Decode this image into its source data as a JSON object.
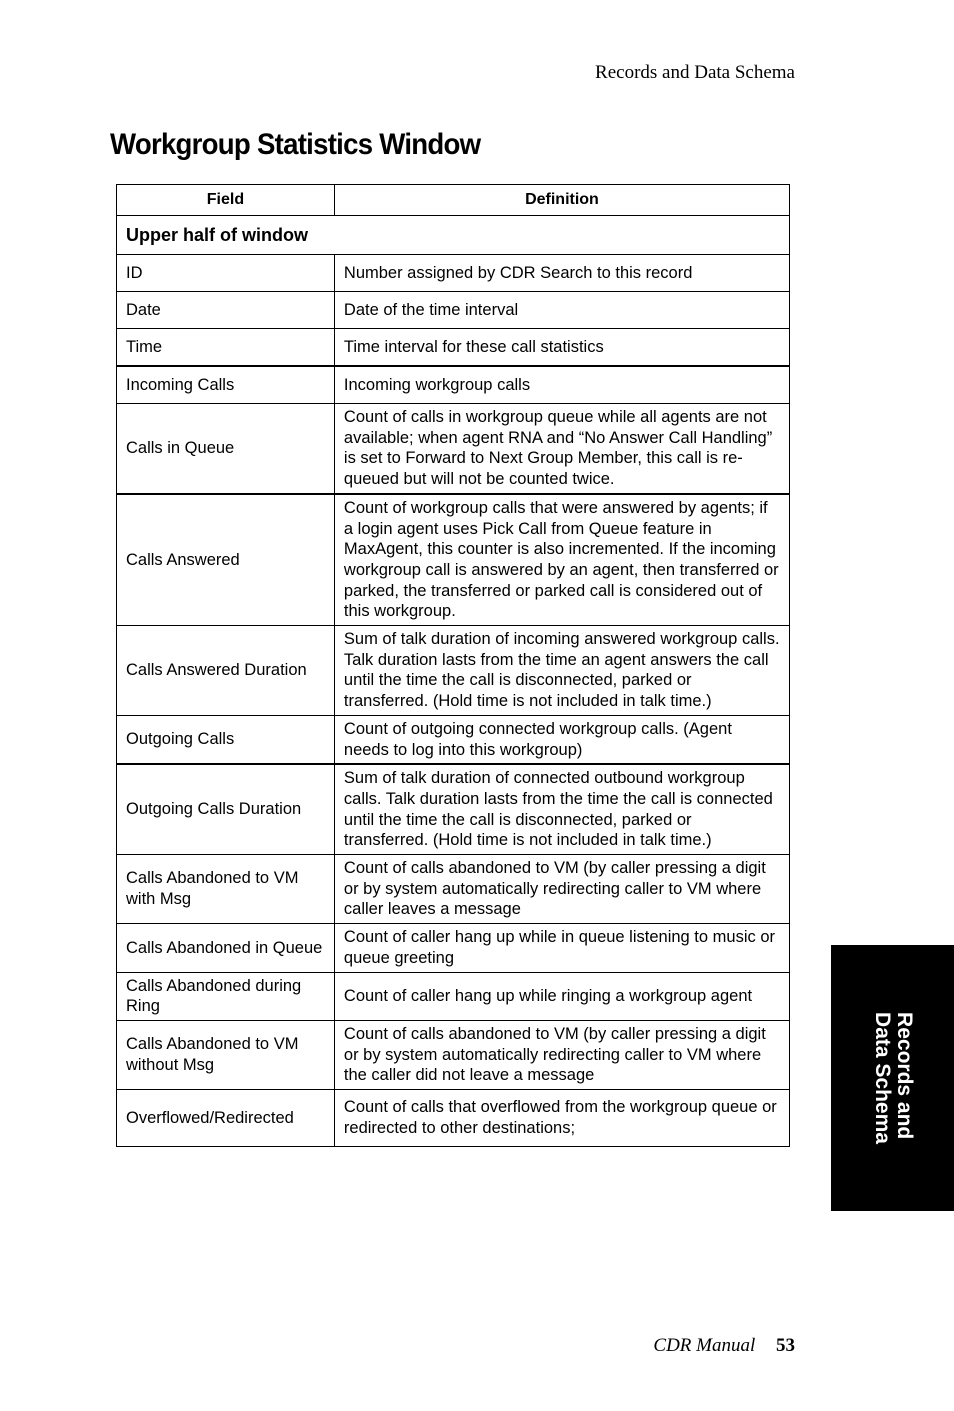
{
  "header": {
    "running_title": "Records and Data Schema"
  },
  "page_title": "Workgroup Statistics Window",
  "table": {
    "columns": [
      "Field",
      "Definition"
    ],
    "section_label": "Upper half of window",
    "rows": [
      {
        "field": "ID",
        "definition": "Number assigned by CDR Search to this record"
      },
      {
        "field": "Date",
        "definition": "Date of the time interval"
      },
      {
        "field": "Time",
        "definition": "Time interval for these call statistics"
      },
      {
        "field": "Incoming Calls",
        "definition": "Incoming workgroup calls"
      },
      {
        "field": "Calls in Queue",
        "definition": "Count of calls in workgroup queue while all agents are not available; when agent RNA and “No Answer Call Handling” is set to Forward to Next Group Member, this call is re-queued but will not be counted twice."
      },
      {
        "field": "Calls Answered",
        "definition": "Count of workgroup calls that were answered by agents; if a login agent uses Pick Call from Queue feature in MaxAgent, this counter is also incremented. If the incoming workgroup call is answered by an agent, then transferred or parked, the transferred or parked call is considered out of this workgroup."
      },
      {
        "field": "Calls Answered Duration",
        "definition": "Sum of talk duration of incoming answered workgroup calls. Talk duration lasts from the time an agent answers the call until the time the call is disconnected, parked or transferred. (Hold time is not included in talk time.)"
      },
      {
        "field": "Outgoing Calls",
        "definition": "Count of outgoing connected workgroup calls. (Agent needs to log into this workgroup)"
      },
      {
        "field": "Outgoing Calls Duration",
        "definition": "Sum of talk duration of connected outbound workgroup calls. Talk duration lasts from the time the call is connected until the time the call is disconnected, parked or transferred. (Hold time is not included in talk time.)"
      },
      {
        "field": "Calls Abandoned to VM with Msg",
        "definition": "Count of calls abandoned to VM (by caller pressing a digit or by system automatically redirecting caller to VM where caller leaves a message"
      },
      {
        "field": "Calls Abandoned in Queue",
        "definition": "Count of caller hang up while in queue listening to music or queue greeting"
      },
      {
        "field": "Calls Abandoned during Ring",
        "definition": "Count of caller hang up while ringing a workgroup agent"
      },
      {
        "field": "Calls Abandoned to VM without Msg",
        "definition": "Count of calls abandoned to VM (by caller pressing a digit or by system automatically redirecting caller to VM where the caller did not leave a message"
      },
      {
        "field": "Overflowed/Redirected",
        "definition": "Count of calls that overflowed from the workgroup queue or redirected to other destinations;"
      }
    ]
  },
  "side_tab": {
    "line1": "Records and",
    "line2": "Data Schema"
  },
  "footer": {
    "manual_name": "CDR Manual",
    "page_number": "53"
  }
}
